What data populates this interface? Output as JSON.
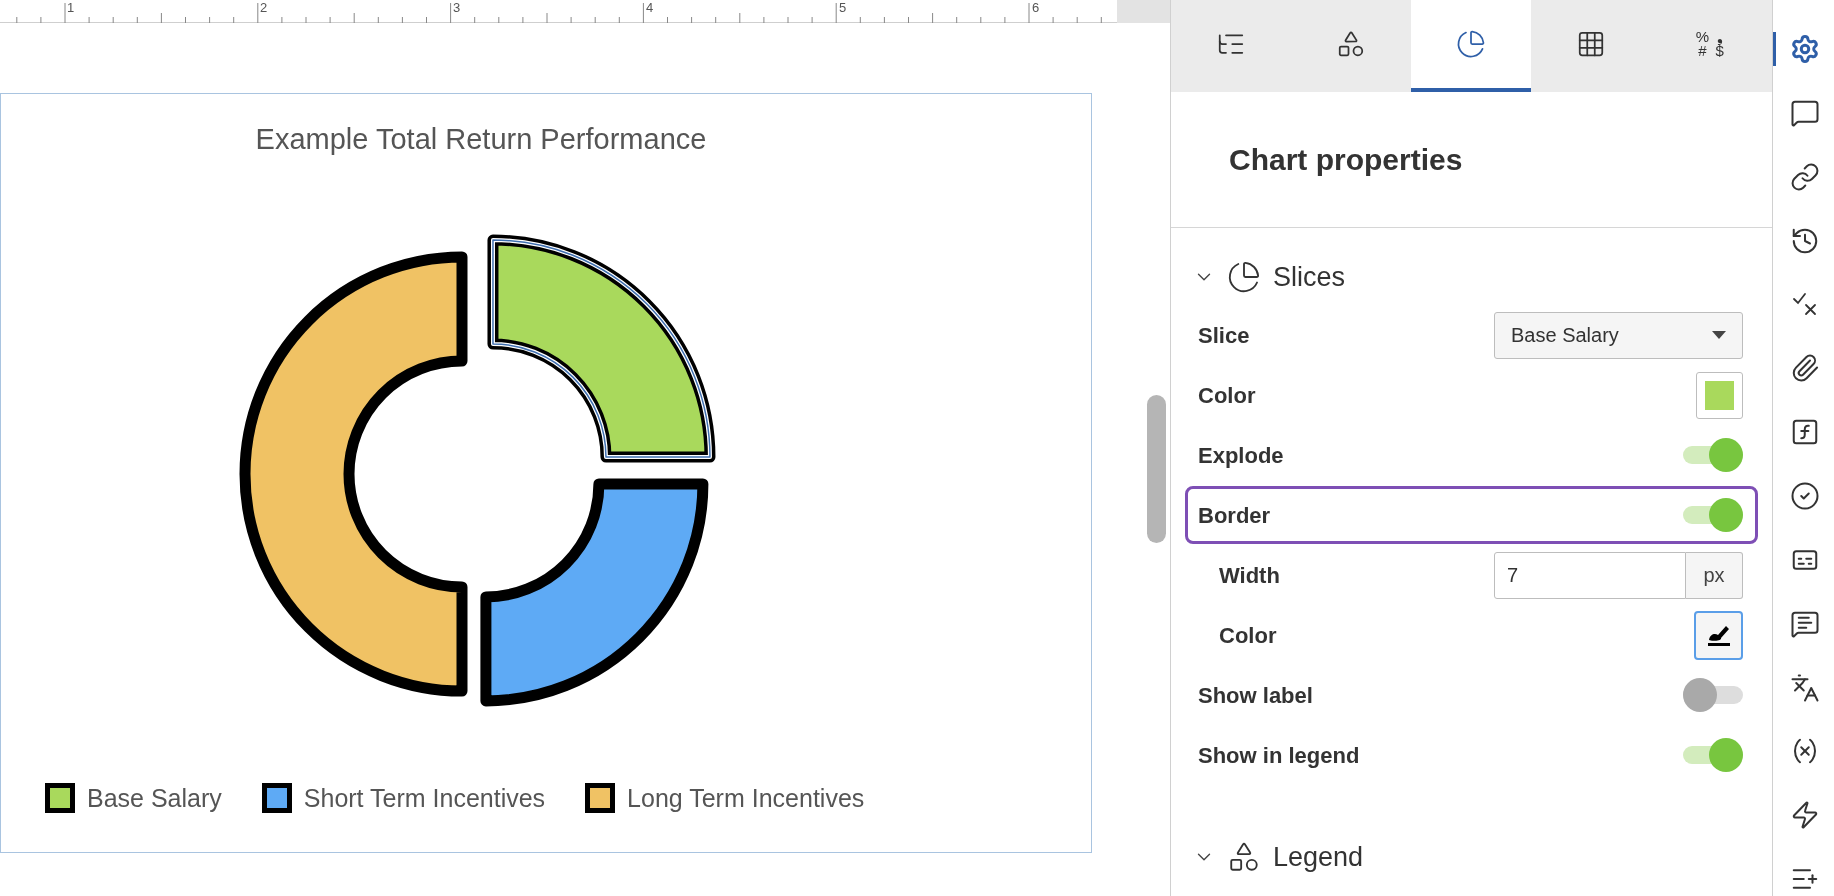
{
  "ruler": {
    "labels": [
      "1",
      "2",
      "3",
      "4",
      "5",
      "6"
    ]
  },
  "chart": {
    "title": "Example Total Return Performance",
    "slices": [
      {
        "color": "#a9d95c",
        "exploded": true,
        "selected": true
      },
      {
        "color": "#5eaaf5",
        "exploded": false,
        "selected": false
      },
      {
        "color": "#f0c264",
        "exploded": false,
        "selected": false
      }
    ],
    "legend": [
      {
        "label": "Base Salary",
        "color": "#a9d95c"
      },
      {
        "label": "Short Term Incentives",
        "color": "#5eaaf5"
      },
      {
        "label": "Long Term Incentives",
        "color": "#f0c264"
      }
    ]
  },
  "panel": {
    "tabs": [
      {
        "kind": "outline",
        "selected": false
      },
      {
        "kind": "shapes",
        "selected": false
      },
      {
        "kind": "chart",
        "selected": true
      },
      {
        "kind": "table",
        "selected": false
      },
      {
        "kind": "number-format",
        "symbols": [
          "%",
          "❟",
          "#",
          "$"
        ],
        "selected": false
      }
    ],
    "title": "Chart properties",
    "sections": [
      {
        "kind": "slices",
        "title": "Slices",
        "expanded": true,
        "rows": [
          {
            "kind": "select",
            "label": "Slice",
            "value": "Base Salary",
            "highlighted": false
          },
          {
            "kind": "color",
            "label": "Color",
            "color": "#a9d95c",
            "highlighted": false
          },
          {
            "kind": "toggle",
            "label": "Explode",
            "on": true,
            "highlighted": false
          },
          {
            "kind": "toggle",
            "label": "Border",
            "on": true,
            "highlighted": true,
            "children": [
              {
                "kind": "number",
                "label": "Width",
                "value": "7",
                "unit": "px"
              },
              {
                "kind": "pen",
                "label": "Color",
                "focused": true
              }
            ]
          },
          {
            "kind": "toggle",
            "label": "Show label",
            "on": false,
            "highlighted": false
          },
          {
            "kind": "toggle",
            "label": "Show in legend",
            "on": true,
            "highlighted": false
          }
        ]
      },
      {
        "kind": "legend",
        "title": "Legend",
        "expanded": true
      }
    ]
  },
  "sidebar": {
    "items": [
      {
        "kind": "settings",
        "selected": true
      },
      {
        "kind": "comment",
        "selected": false
      },
      {
        "kind": "link",
        "selected": false
      },
      {
        "kind": "history",
        "selected": false
      },
      {
        "kind": "check-cross",
        "selected": false
      },
      {
        "kind": "attachment",
        "selected": false
      },
      {
        "kind": "function",
        "selected": false
      },
      {
        "kind": "approve",
        "selected": false
      },
      {
        "kind": "cards",
        "selected": false
      },
      {
        "kind": "note",
        "selected": false
      },
      {
        "kind": "translate",
        "selected": false
      },
      {
        "kind": "variable",
        "selected": false
      },
      {
        "kind": "action",
        "selected": false
      },
      {
        "kind": "add-row",
        "selected": false
      }
    ]
  }
}
